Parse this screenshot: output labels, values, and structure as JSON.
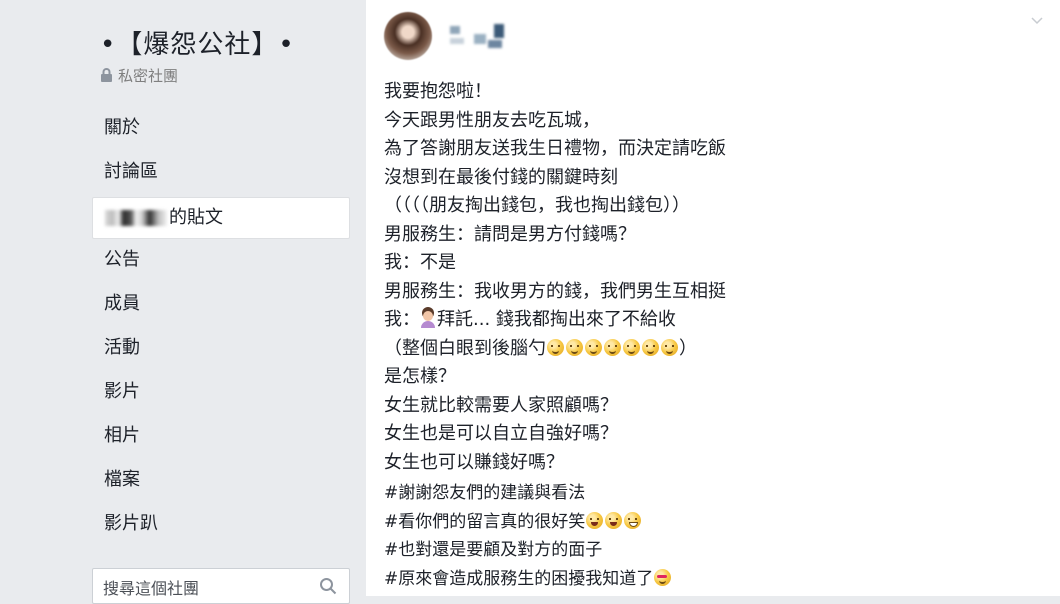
{
  "sidebar": {
    "group_title": "•【爆怨公社】•",
    "privacy_label": "私密社團",
    "nav_items": [
      {
        "label": "關於"
      },
      {
        "label": "討論區"
      },
      {
        "label": "的貼文"
      },
      {
        "label": "公告"
      },
      {
        "label": "成員"
      },
      {
        "label": "活動"
      },
      {
        "label": "影片"
      },
      {
        "label": "相片"
      },
      {
        "label": "檔案"
      },
      {
        "label": "影片趴"
      }
    ],
    "search_placeholder": "搜尋這個社團"
  },
  "post": {
    "lines": [
      "我要抱怨啦！",
      "今天跟男性朋友去吃瓦城，",
      "為了答謝朋友送我生日禮物，而決定請吃飯",
      "沒想到在最後付錢的關鍵時刻",
      "（（（（朋友掏出錢包，我也掏出錢包））",
      "男服務生：請問是男方付錢嗎？",
      "我：不是",
      "男服務生：我收男方的錢，我們男生互相挺",
      "我：",
      "拜託... 錢我都掏出來了不給收",
      "（整個白眼到後腦勺",
      "）",
      "是怎樣？",
      "女生就比較需要人家照顧嗎？",
      "女生也是可以自立自強好嗎？",
      "女生也可以賺錢好嗎？"
    ],
    "hashtags": [
      "#謝謝怨友們的建議與看法",
      "#看你們的留言真的很好笑",
      "#也對還是要顧及對方的面子",
      "#原來會造成服務生的困擾我知道了"
    ]
  },
  "icons": {
    "lock": "lock-icon",
    "search": "search-icon",
    "chevron": "chevron-down-icon",
    "emoji_eyeroll": "rolling-eyes-emoji",
    "emoji_laugh": "tears-of-joy-emoji",
    "emoji_grin": "grinning-squint-emoji",
    "emoji_heart_eyes": "heart-eyes-emoji",
    "emoji_person": "person-facepalming-emoji"
  },
  "colors": {
    "sidebar_bg": "#e9ebee",
    "text": "#1d2129",
    "muted": "#7f7f7f"
  }
}
